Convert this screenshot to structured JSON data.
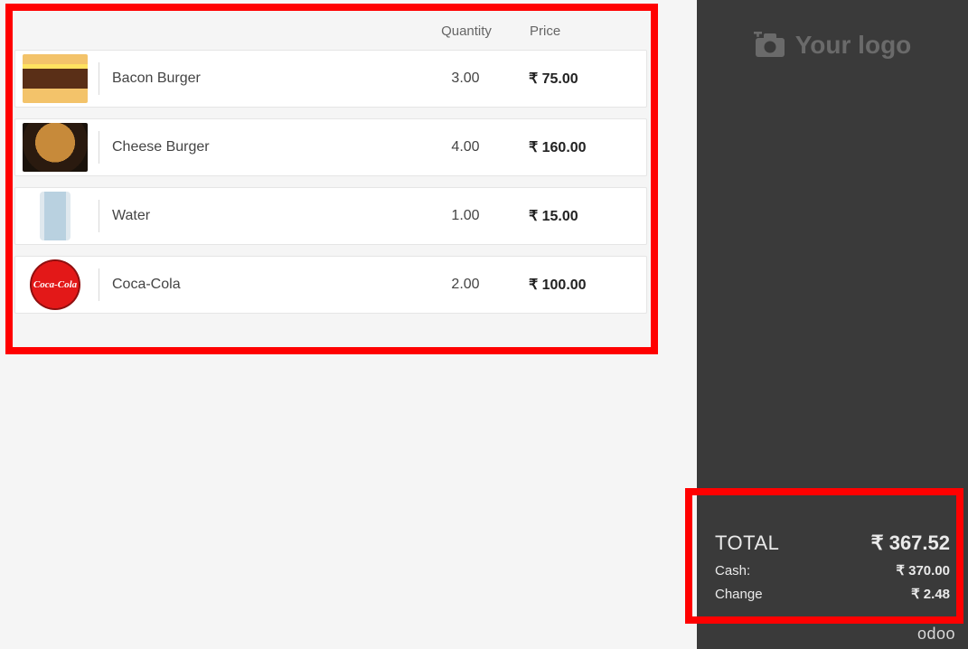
{
  "headers": {
    "quantity": "Quantity",
    "price": "Price"
  },
  "currency": "₹",
  "items": [
    {
      "name": "Bacon Burger",
      "qty": "3.00",
      "price": "75.00",
      "thumb": "burger1"
    },
    {
      "name": "Cheese Burger",
      "qty": "4.00",
      "price": "160.00",
      "thumb": "burger2"
    },
    {
      "name": "Water",
      "qty": "1.00",
      "price": "15.00",
      "thumb": "water"
    },
    {
      "name": "Coca-Cola",
      "qty": "2.00",
      "price": "100.00",
      "thumb": "coke"
    }
  ],
  "logo_placeholder": "Your logo",
  "totals": {
    "total_label": "TOTAL",
    "total_value": "367.52",
    "cash_label": "Cash:",
    "cash_value": "370.00",
    "change_label": "Change",
    "change_value": "2.48"
  },
  "brand": "odoo"
}
